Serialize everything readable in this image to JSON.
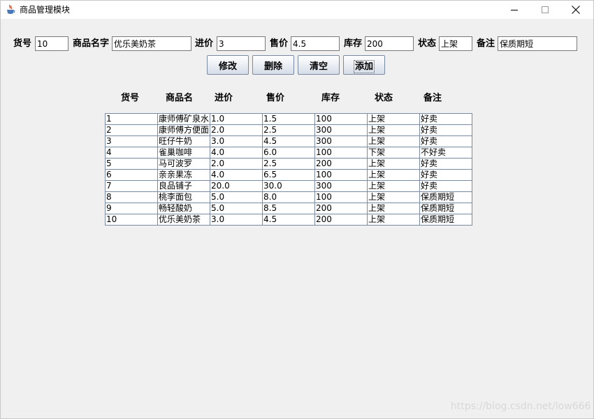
{
  "window": {
    "title": "商品管理模块"
  },
  "form": {
    "labels": [
      "货号",
      "商品名字",
      "进价",
      "售价",
      "库存",
      "状态",
      "备注"
    ],
    "values": [
      "10",
      "优乐美奶茶",
      "3",
      "4.5",
      "200",
      "上架",
      "保质期短"
    ]
  },
  "buttons": [
    "修改",
    "删除",
    "清空",
    "添加"
  ],
  "table": {
    "headers": [
      "货号",
      "商品名",
      "进价",
      "售价",
      "库存",
      "状态",
      "备注"
    ],
    "rows": [
      [
        "1",
        "康师傅矿泉水",
        "1.0",
        "1.5",
        "100",
        "上架",
        "好卖"
      ],
      [
        "2",
        "康师傅方便面",
        "2.0",
        "2.5",
        "300",
        "上架",
        "好卖"
      ],
      [
        "3",
        "旺仔牛奶",
        "3.0",
        "4.5",
        "300",
        "上架",
        "好卖"
      ],
      [
        "4",
        "雀巢咖啡",
        "4.0",
        "6.0",
        "100",
        "下架",
        "不好卖"
      ],
      [
        "5",
        "马可波罗",
        "2.0",
        "2.5",
        "200",
        "上架",
        "好卖"
      ],
      [
        "6",
        "亲亲果冻",
        "4.0",
        "6.5",
        "100",
        "上架",
        "好卖"
      ],
      [
        "7",
        "良品铺子",
        "20.0",
        "30.0",
        "300",
        "上架",
        "好卖"
      ],
      [
        "8",
        "桃李面包",
        "5.0",
        "8.0",
        "100",
        "上架",
        "保质期短"
      ],
      [
        "9",
        "畅轻酸奶",
        "5.0",
        "8.5",
        "200",
        "上架",
        "保质期短"
      ],
      [
        "10",
        "优乐美奶茶",
        "3.0",
        "4.5",
        "200",
        "上架",
        "保质期短"
      ]
    ]
  },
  "watermark": "https://blog.csdn.net/low666"
}
